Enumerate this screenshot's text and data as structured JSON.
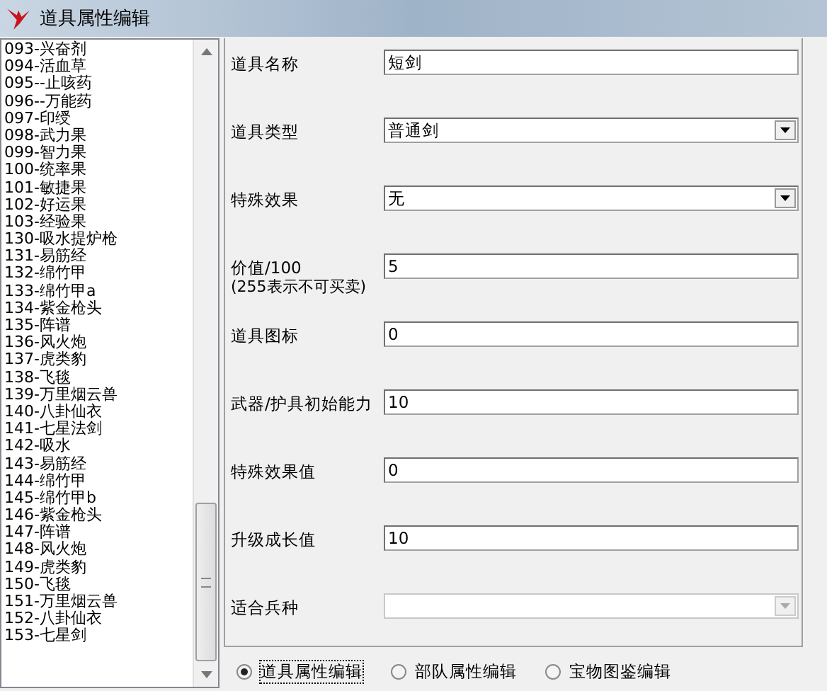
{
  "window": {
    "title": "道具属性编辑"
  },
  "item_list": {
    "items": [
      "093-兴奋剂",
      "094-活血草",
      "095--止咳药",
      "096--万能药",
      "097-印绶",
      "098-武力果",
      "099-智力果",
      "100-统率果",
      "101-敏捷果",
      "102-好运果",
      "103-经验果",
      "130-吸水提炉枪",
      "131-易筋经",
      "132-绵竹甲",
      "133-绵竹甲a",
      "134-紫金枪头",
      "135-阵谱",
      "136-风火炮",
      "137-虎类豹",
      "138-飞毯",
      "139-万里烟云兽",
      "140-八卦仙衣",
      "141-七星法剑",
      "142-吸水",
      "143-易筋经",
      "144-绵竹甲",
      "145-绵竹甲b",
      "146-紫金枪头",
      "147-阵谱",
      "148-风火炮",
      "149-虎类豹",
      "150-飞毯",
      "151-万里烟云兽",
      "152-八卦仙衣",
      "153-七星剑"
    ]
  },
  "fields": [
    {
      "label": "道具名称",
      "kind": "text",
      "value": "短剑"
    },
    {
      "label": "道具类型",
      "kind": "select",
      "value": "普通剑",
      "disabled": false
    },
    {
      "label": "特殊效果",
      "kind": "select",
      "value": "无",
      "disabled": false
    },
    {
      "label": "价值/100",
      "note": "(255表示不可买卖)",
      "kind": "text",
      "value": "5"
    },
    {
      "label": "道具图标",
      "kind": "text",
      "value": "0"
    },
    {
      "label": "武器/护具初始能力",
      "kind": "text",
      "value": "10"
    },
    {
      "label": "特殊效果值",
      "kind": "text",
      "value": "0"
    },
    {
      "label": "升级成长值",
      "kind": "text",
      "value": "10"
    },
    {
      "label": "适合兵种",
      "kind": "select",
      "disabled": true
    }
  ],
  "modes": [
    {
      "label": "道具属性编辑",
      "selected": true
    },
    {
      "label": "部队属性编辑",
      "selected": false
    },
    {
      "label": "宝物图鉴编辑",
      "selected": false
    }
  ]
}
